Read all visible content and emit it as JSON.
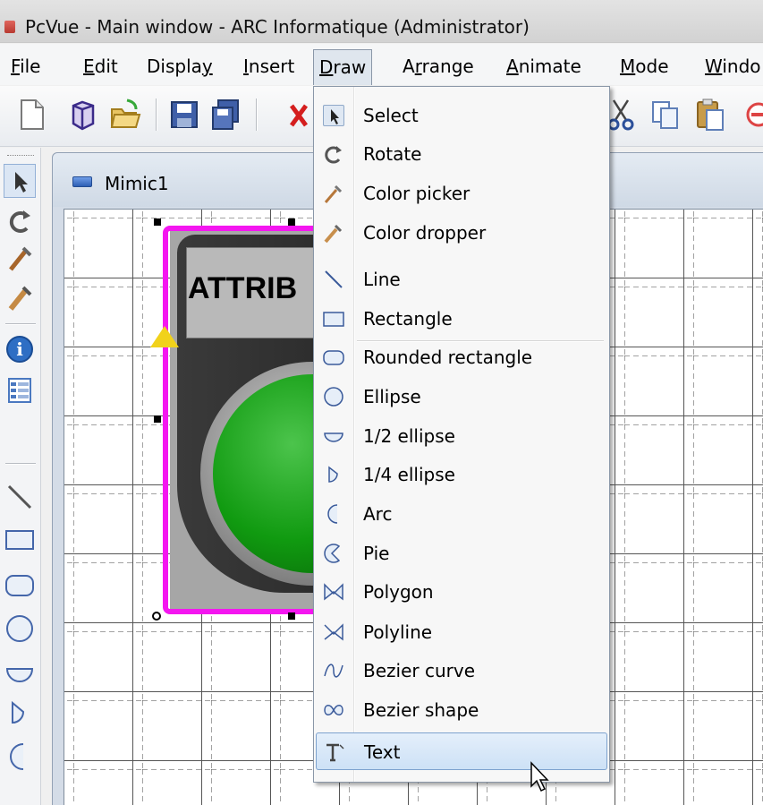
{
  "window": {
    "title": "PcVue - Main window - ARC Informatique (Administrator)"
  },
  "menubar": {
    "items": [
      {
        "pre": "",
        "key": "F",
        "post": "ile"
      },
      {
        "pre": "",
        "key": "E",
        "post": "dit"
      },
      {
        "pre": "Displa",
        "key": "y",
        "post": ""
      },
      {
        "pre": "",
        "key": "I",
        "post": "nsert"
      },
      {
        "pre": "",
        "key": "D",
        "post": "raw"
      },
      {
        "pre": "A",
        "key": "r",
        "post": "range"
      },
      {
        "pre": "",
        "key": "A",
        "post": "nimate"
      },
      {
        "pre": "",
        "key": "M",
        "post": "ode"
      },
      {
        "pre": "",
        "key": "W",
        "post": "indo"
      }
    ],
    "open_menu": "Draw"
  },
  "mimic": {
    "title": "Mimic1",
    "button_label": "ATTRIB"
  },
  "draw_menu": {
    "items": [
      {
        "label": "Select",
        "icon": "arrow-pointer-icon",
        "checked": true
      },
      {
        "label": "Rotate",
        "icon": "rotate-icon"
      },
      {
        "label": "Color picker",
        "icon": "color-picker-icon"
      },
      {
        "label": "Color dropper",
        "icon": "color-dropper-icon"
      },
      {
        "label": "Line",
        "icon": "line-icon"
      },
      {
        "label": "Rectangle",
        "icon": "rectangle-icon"
      },
      {
        "label": "Rounded rectangle",
        "icon": "rounded-rectangle-icon"
      },
      {
        "label": "Ellipse",
        "icon": "ellipse-icon"
      },
      {
        "label": "1/2 ellipse",
        "icon": "half-ellipse-icon"
      },
      {
        "label": "1/4 ellipse",
        "icon": "quarter-ellipse-icon"
      },
      {
        "label": "Arc",
        "icon": "arc-icon"
      },
      {
        "label": "Pie",
        "icon": "pie-icon"
      },
      {
        "label": "Polygon",
        "icon": "polygon-icon"
      },
      {
        "label": "Polyline",
        "icon": "polyline-icon"
      },
      {
        "label": "Bezier curve",
        "icon": "bezier-curve-icon"
      },
      {
        "label": "Bezier shape",
        "icon": "bezier-shape-icon"
      },
      {
        "label": "Text",
        "icon": "text-icon",
        "highlighted": true
      }
    ]
  },
  "colors": {
    "selection_border": "#f416f0",
    "menu_highlight": "#cde1f6",
    "button_green": "#109a10"
  }
}
